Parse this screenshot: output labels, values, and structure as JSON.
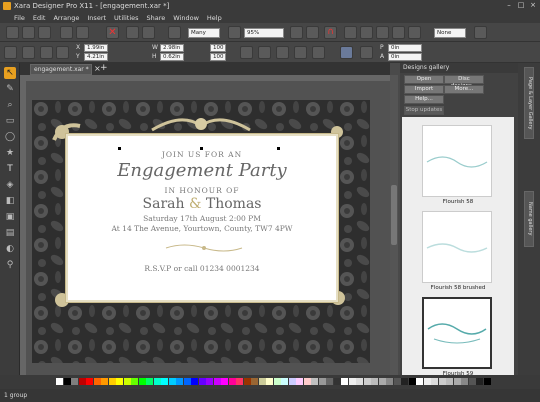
{
  "window": {
    "title": "Xara Designer Pro X11 - [engagement.xar *]"
  },
  "menu": [
    "File",
    "Edit",
    "Arrange",
    "Insert",
    "Utilities",
    "Share",
    "Window",
    "Help"
  ],
  "toolbar": {
    "zoom_mode": "Many",
    "zoom_value": "95%",
    "quality": "None"
  },
  "infobar": {
    "x": "1.99in",
    "y": "4.21in",
    "w": "2.98in",
    "h": "0.62in",
    "sx": "100",
    "sy": "100",
    "p": "0in",
    "a": "0in",
    "x_label": "X",
    "y_label": "Y",
    "w_label": "W",
    "h_label": "H",
    "p_label": "P",
    "a_label": "A"
  },
  "doc_tab": {
    "label": "engagement.xar *"
  },
  "card": {
    "line1": "JOIN US FOR AN",
    "line2": "Engagement Party",
    "line3": "IN HONOUR OF",
    "name1": "Sarah",
    "amp": "&",
    "name2": "Thomas",
    "date": "Saturday 17th August 2:00 PM",
    "address": "At 14 The Avenue, Yourtown, County, TW7 4PW",
    "rsvp": "R.S.V.P or call 01234 0001234"
  },
  "gallery": {
    "title": "Designs gallery",
    "buttons": [
      "Open",
      "Disc designs...",
      "Import",
      "More...",
      "Help...",
      "Stop updates"
    ],
    "items": [
      {
        "label": "Flourish 58"
      },
      {
        "label": "Flourish 58 brushed"
      },
      {
        "label": "Flourish 59"
      }
    ]
  },
  "side_tabs": [
    "Page & Layer Gallery",
    "Name gallery"
  ],
  "status": {
    "text": "1 group"
  },
  "colors": {
    "accent": "#c8b98a",
    "text_gray": "#777777"
  },
  "palette": [
    "#ffffff",
    "#000000",
    "#7f7f7f",
    "#c00000",
    "#ff0000",
    "#ff6600",
    "#ff9900",
    "#ffcc00",
    "#ffff00",
    "#ccff00",
    "#66ff00",
    "#00ff00",
    "#00ff66",
    "#00ffcc",
    "#00ffff",
    "#00ccff",
    "#0099ff",
    "#0066ff",
    "#0000ff",
    "#6600ff",
    "#9900ff",
    "#cc00ff",
    "#ff00ff",
    "#ff0099",
    "#ff3366",
    "#993300",
    "#996633",
    "#cccc99",
    "#ffffcc",
    "#ccffcc",
    "#ccffff",
    "#ccccff",
    "#ffccff",
    "#ffcccc",
    "#c0c0c0",
    "#999999",
    "#666666",
    "#333333",
    "#ffffff",
    "#eeeeee",
    "#dddddd",
    "#cccccc",
    "#bbbbbb",
    "#aaaaaa",
    "#888888",
    "#555555",
    "#222222",
    "#000000",
    "#ffffff",
    "#eeeeee",
    "#dddddd",
    "#cccccc",
    "#bbbbbb",
    "#aaaaaa",
    "#888888",
    "#555555",
    "#222222",
    "#000000"
  ]
}
